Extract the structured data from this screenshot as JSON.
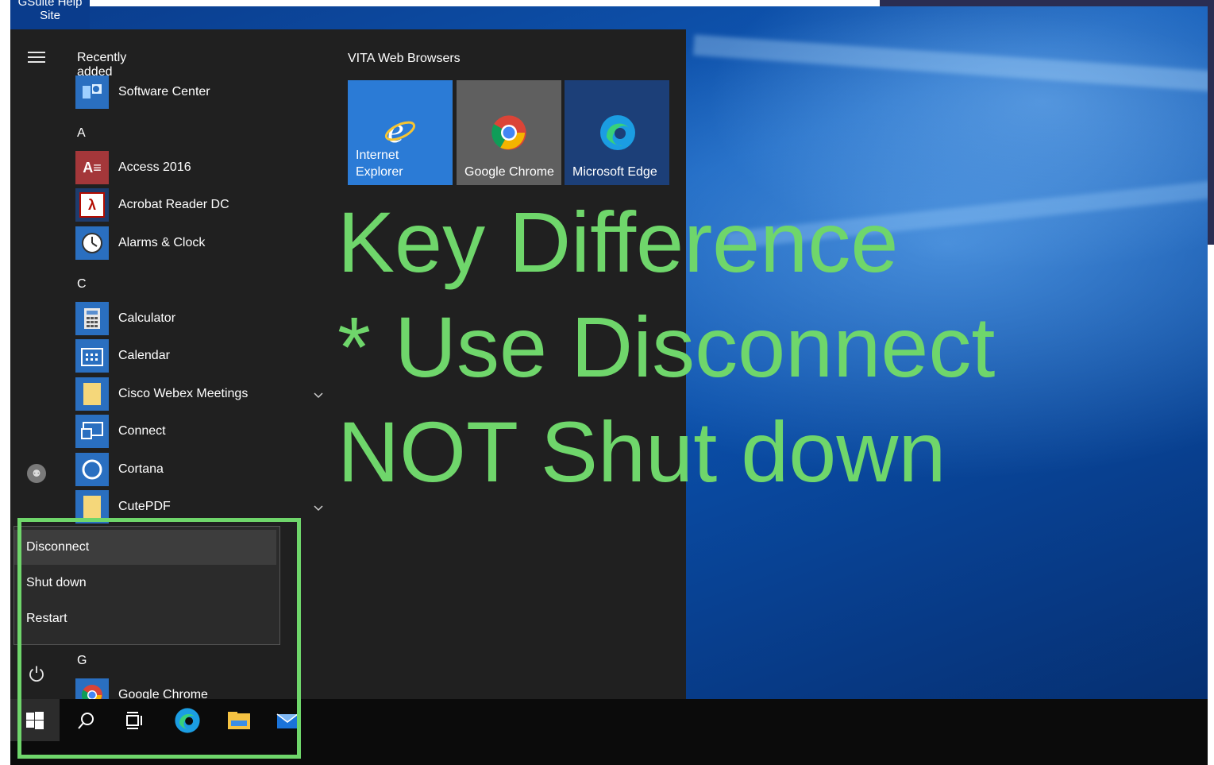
{
  "window": {
    "site_label_line1": "GSuite Help",
    "site_label_line2": "Site"
  },
  "start_menu": {
    "recently_added_label": "Recently added",
    "recent_app": {
      "label": "Software Center",
      "icon": "software-center-icon"
    },
    "sections": [
      {
        "letter": "A",
        "apps": [
          {
            "label": "Access 2016",
            "icon": "access-icon"
          },
          {
            "label": "Acrobat Reader DC",
            "icon": "acrobat-icon"
          },
          {
            "label": "Alarms & Clock",
            "icon": "clock-icon"
          }
        ]
      },
      {
        "letter": "C",
        "apps": [
          {
            "label": "Calculator",
            "icon": "calculator-icon"
          },
          {
            "label": "Calendar",
            "icon": "calendar-icon"
          },
          {
            "label": "Cisco Webex Meetings",
            "icon": "folder-icon",
            "expandable": true
          },
          {
            "label": "Connect",
            "icon": "connect-icon"
          },
          {
            "label": "Cortana",
            "icon": "cortana-icon"
          },
          {
            "label": "CutePDF",
            "icon": "folder-icon",
            "expandable": true
          }
        ]
      },
      {
        "letter": "G",
        "apps": [
          {
            "label": "Google Chrome",
            "icon": "chrome-icon"
          }
        ]
      }
    ],
    "tiles_group_label": "VITA Web Browsers",
    "tiles": [
      {
        "label_line1": "Internet",
        "label_line2": "Explorer",
        "color": "#2b7bd6",
        "icon": "internet-explorer-icon"
      },
      {
        "label_line1": "",
        "label_line2": "Google Chrome",
        "color": "#5f5f5f",
        "icon": "chrome-icon"
      },
      {
        "label_line1": "",
        "label_line2": "Microsoft Edge",
        "color": "#1c3f78",
        "icon": "edge-icon"
      }
    ],
    "power_menu": {
      "items": [
        "Disconnect",
        "Shut down",
        "Restart"
      ],
      "active": "Disconnect"
    }
  },
  "overlay": {
    "line1": "Key Difference",
    "line2": "* Use Disconnect",
    "line3": "NOT Shut down",
    "color": "#6fd66b"
  },
  "taskbar": {
    "items": [
      "start-icon",
      "search-icon",
      "task-view-icon",
      "edge-icon",
      "file-explorer-icon",
      "mail-icon"
    ]
  }
}
